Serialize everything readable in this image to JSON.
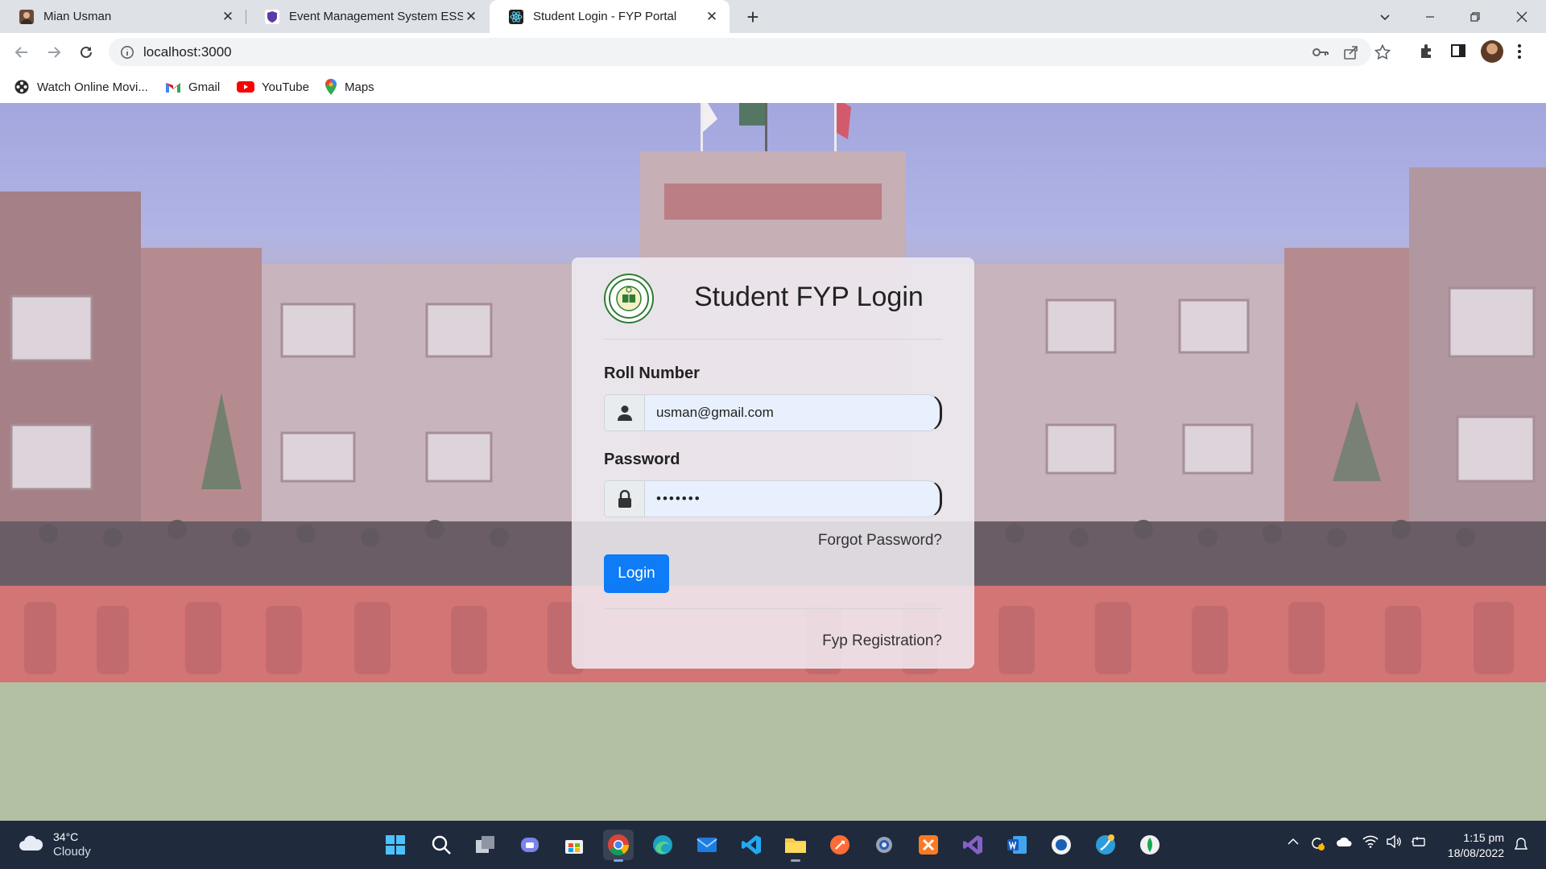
{
  "browser": {
    "tabs": [
      {
        "title": "Mian Usman",
        "active": false
      },
      {
        "title": "Event Management System ESSE",
        "active": false
      },
      {
        "title": "Student Login - FYP Portal",
        "active": true
      }
    ],
    "url": "localhost:3000",
    "bookmarks": [
      {
        "label": "Watch Online Movi...",
        "icon": "film-reel-icon"
      },
      {
        "label": "Gmail",
        "icon": "gmail-icon"
      },
      {
        "label": "YouTube",
        "icon": "youtube-icon"
      },
      {
        "label": "Maps",
        "icon": "maps-pin-icon"
      }
    ]
  },
  "page": {
    "background": "university-building-group-photo",
    "card": {
      "title": "Student FYP Login",
      "roll_label": "Roll Number",
      "roll_value": "usman@gmail.com",
      "password_label": "Password",
      "password_value": "•••••••",
      "forgot_link": "Forgot Password?",
      "login_button": "Login",
      "register_link": "Fyp Registration?"
    },
    "accent_color": "#0d7cf6"
  },
  "taskbar": {
    "weather": {
      "temp": "34°C",
      "condition": "Cloudy"
    },
    "time": "1:15 pm",
    "date": "18/08/2022"
  }
}
